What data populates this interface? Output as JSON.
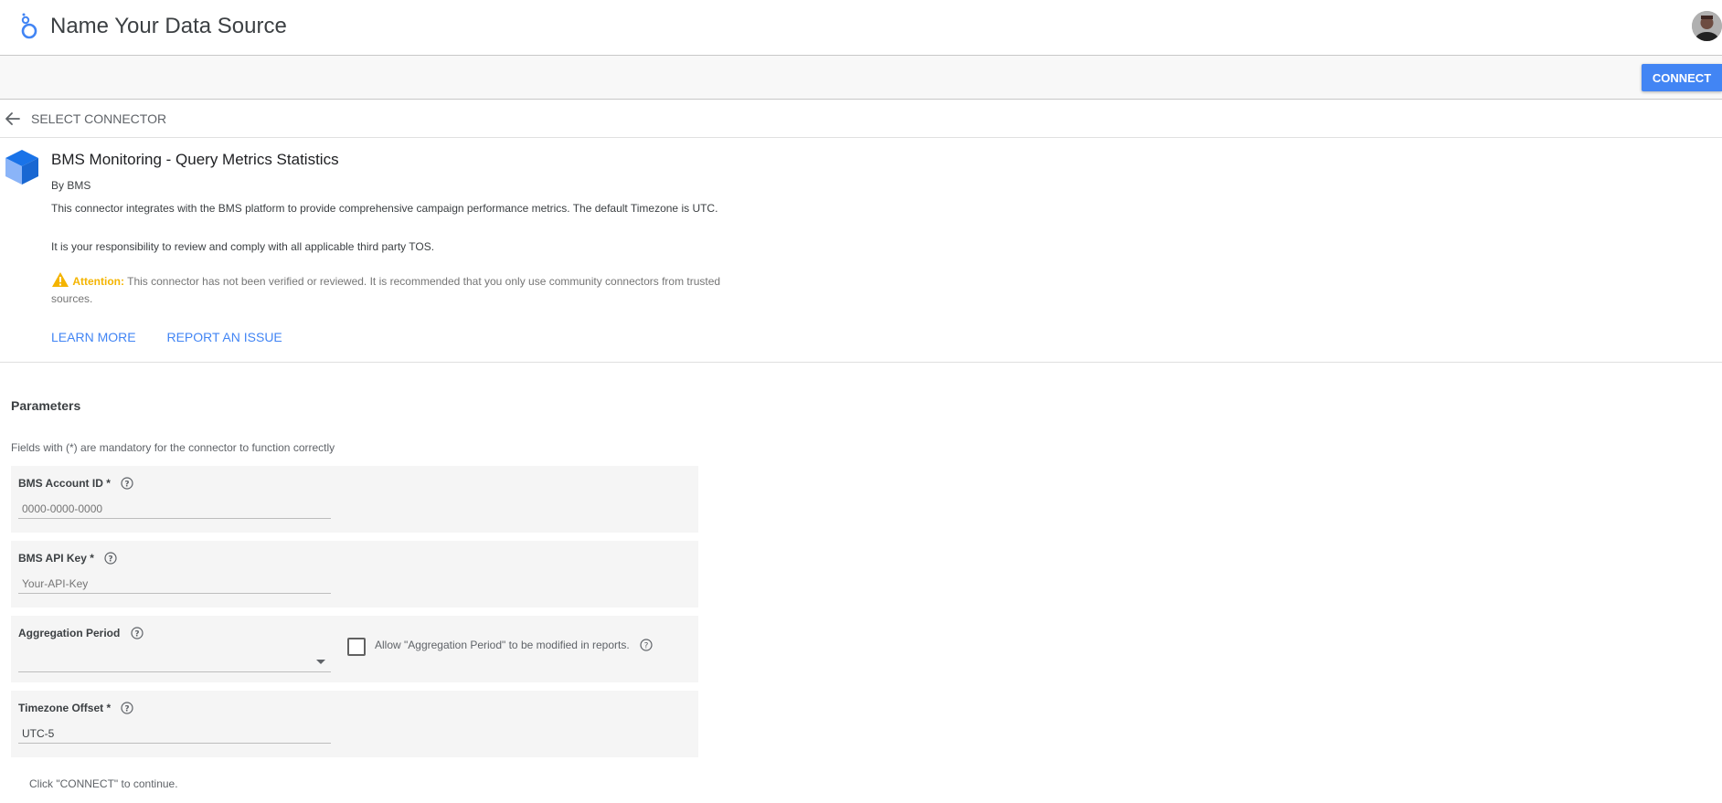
{
  "header": {
    "title": "Name Your Data Source",
    "logo_icon": "looker-studio-logo-icon",
    "avatar_icon": "user-avatar-icon"
  },
  "toolbar": {
    "connect_label": "CONNECT",
    "connect_color": "#4285f4"
  },
  "nav": {
    "back_icon": "arrow-left-icon",
    "select_connector_label": "SELECT CONNECTOR"
  },
  "connector": {
    "icon": "cube-icon",
    "name": "BMS Monitoring - Query Metrics Statistics",
    "by": "By BMS",
    "description": "This connector integrates with the BMS platform to provide comprehensive campaign performance metrics. The default Timezone is UTC.",
    "responsibility": "It is your responsibility to review and comply with all applicable third party TOS.",
    "attention_label": "Attention:",
    "attention_text": "This connector has not been verified or reviewed. It is recommended that you only use community connectors from trusted sources.",
    "learn_more_label": "LEARN MORE",
    "report_issue_label": "REPORT AN ISSUE",
    "warning_color": "#f4b400"
  },
  "parameters": {
    "title": "Parameters",
    "mandatory_note": "Fields with (*) are mandatory for the connector to function correctly",
    "fields": [
      {
        "label": "BMS Account ID *",
        "placeholder": "0000-0000-0000",
        "value": ""
      },
      {
        "label": "BMS API Key *",
        "placeholder": "Your-API-Key",
        "value": ""
      },
      {
        "label": "Aggregation Period",
        "selected": "",
        "checkbox_label": "Allow \"Aggregation Period\" to be modified in reports."
      },
      {
        "label": "Timezone Offset *",
        "placeholder": "",
        "value": "UTC-5"
      }
    ]
  },
  "footer": {
    "note": "Click \"CONNECT\" to continue."
  }
}
